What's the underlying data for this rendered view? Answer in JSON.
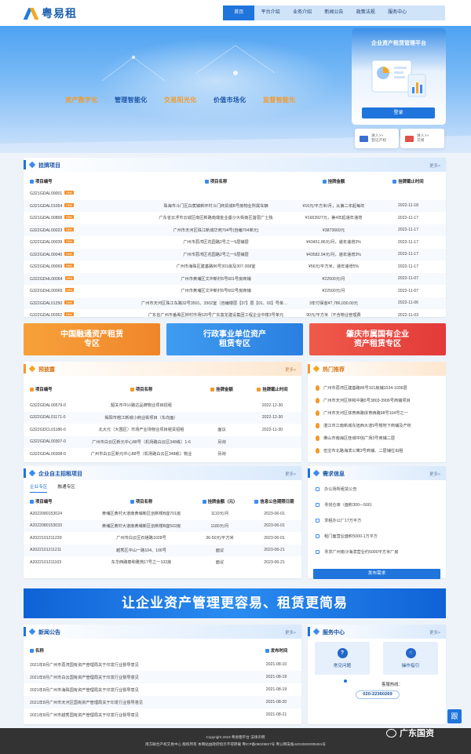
{
  "brand": {
    "name": "粤易租"
  },
  "nav": {
    "items": [
      "首页",
      "平台介绍",
      "业务介绍",
      "新闻公告",
      "政策法规",
      "服务中心"
    ],
    "active": 0
  },
  "banner": {
    "features": [
      {
        "text": "资产数字化",
        "color": "#f39a2b"
      },
      {
        "text": "管理智能化",
        "color": "#1b55a8"
      },
      {
        "text": "交易阳光化",
        "color": "#f39a2b"
      },
      {
        "text": "价值市场化",
        "color": "#1b55a8"
      },
      {
        "text": "监督智能化",
        "color": "#f39a2b"
      }
    ],
    "login_panel": {
      "title": "企业资产租赁管理平台",
      "login_btn": "登录"
    },
    "quick_btns": [
      {
        "line1": "进入>>",
        "line2": "登记产权",
        "icon": "id-card-icon",
        "color": "#3b6fd1"
      },
      {
        "line1": "进入>>",
        "line2": "交易",
        "icon": "cart-icon",
        "color": "#e1504a"
      }
    ]
  },
  "listed": {
    "title": "挂牌项目",
    "more": "更多>",
    "headers": [
      "项目编号",
      "项目名称",
      "挂牌金额",
      "挂牌截止时间"
    ],
    "rows": [
      {
        "id": "G321GDAL00001",
        "name": "",
        "amount": "",
        "date": ""
      },
      {
        "id": "G321GDAL01054",
        "name": "珠海市斗门区白蕉镇新环村斗门商贸城B号房物业所属车辆",
        "amount": "¥16元/平方米/月，从第二年起每年",
        "date": "2022-11-18"
      },
      {
        "id": "G321GDAL00868",
        "name": "广东省云浮市云城区南区新路南端金业垂沙大街南区首层广士独",
        "amount": "¥1663927元，第4年起递年递增",
        "date": "2022-11-17"
      },
      {
        "id": "G322GDAL00023",
        "name": "广州市天河区珠江新城华苑704号(自编704单元)",
        "amount": "¥3873669元",
        "date": "2022-11-17"
      },
      {
        "id": "G322GDAL00039",
        "name": "广州市荔湾区花园路2号之一5层铺层",
        "amount": "¥43451.86元/月，递年递增3%",
        "date": "2022-11-17"
      },
      {
        "id": "G322GDAL00040",
        "name": "广州市荔湾区花园路2号之一6层铺层",
        "amount": "¥43582.94元/月，递年递增3%",
        "date": "2022-11-17"
      },
      {
        "id": "G322GDAL00069",
        "name": "广州市海珠区建基路86号301房及307-308室",
        "amount": "¥56元/平方米，递年递增5%",
        "date": "2022-11-17"
      },
      {
        "id": "G322GDHL00064",
        "name": "广州市黄埔区文冲新村6号601号房商铺",
        "amount": "¥22500元/月",
        "date": "2022-11-07"
      },
      {
        "id": "G322GDHL00065",
        "name": "广州市黄埔区文冲新村6号602号房商铺",
        "amount": "¥22500元/月",
        "date": "2022-11-07"
      },
      {
        "id": "G322GDAL01250",
        "name": "广州市天河区珠江东路32号3501、3502室（自编楼层【37】层【01、02】号单元）",
        "amount": "3年付保金¥7,786,030.00元",
        "date": "2022-11-06"
      },
      {
        "id": "G322GDAL00362",
        "name": "广东省广州市番禺区钟村市场520号广东富龙建设集团工程企业中楼3号单元",
        "amount": "90元/平方米（不含物业管理费",
        "date": "2022-11-03"
      }
    ]
  },
  "zones": [
    {
      "line1": "中国融通资产租赁",
      "line2": "专区",
      "color": "#f39a2b"
    },
    {
      "line1": "行政事业单位资产",
      "line2": "租赁专区",
      "color": "#2f8ce8"
    },
    {
      "line1": "肇庆市属国有企业",
      "line2": "资产租赁专区",
      "color": "#e9483f"
    }
  ],
  "preview": {
    "title": "预披露",
    "more": "更多>",
    "headers": [
      "项目编号",
      "项目名称",
      "挂牌金额",
      "挂牌截止时间"
    ],
    "rows": [
      {
        "id": "G322GDAL00579-0",
        "name": "韶关市中兴路达品牌物业项目招租",
        "amount": "",
        "date": "2022-12-30"
      },
      {
        "id": "G322GDAL01171-0",
        "name": "揭阳市榕江新城小商业街项目（东向面）",
        "amount": "",
        "date": "2022-12-30"
      },
      {
        "id": "G322GDCL01186-0",
        "name": "北大元（大围区）市场产业场物业项目租赁招租",
        "amount": "面议",
        "date": "2022-11-30"
      },
      {
        "id": "G322GDAL00307-0",
        "name": "广州市白云区新元中心88号（机场路白云区348栋）1-6",
        "amount": "另询",
        "date": ""
      },
      {
        "id": "G322GDAL00308-0",
        "name": "广州市白云区新元中心88号（机场路白云区348栋）物业",
        "amount": "另询",
        "date": ""
      }
    ]
  },
  "hot": {
    "title": "热门推荐",
    "items": [
      "广州市荔湾区建基路86号101房铺1034-1036层",
      "广州市天河区林和中路5号3803-3906号商铺项目",
      "广州市天河区体育西路体育西路98号104号之一",
      "湛江市江南新城东旭西大道9号楼地下商铺及产权",
      "佛山市南海区桂城中信广场3号商铺二层",
      "伍宝市北路海滨公寓3号商铺、二层铺位出租"
    ]
  },
  "recruit": {
    "title": "企业自主招租项目",
    "more": "更多>",
    "tabs": [
      "企业专区",
      "融通专区"
    ],
    "headers": [
      "项目编号",
      "项目名称",
      "挂牌金额（元）",
      "信息公告期限日期"
    ],
    "rows": [
      {
        "id": "A2022080153024",
        "name": "黄埔区黄村大道南黄埔新区创新楼B座701房",
        "amount": "1110元/月",
        "date": "2023-06-01"
      },
      {
        "id": "A2022080153033",
        "name": "黄埔区黄村大道南黄埔新区创新楼B座502房",
        "amount": "1180元/月",
        "date": "2023-06-01"
      },
      {
        "id": "A2022101211239",
        "name": "广州市白云区石槎路1028号",
        "amount": "36-50元/平方米",
        "date": "2023-06-01"
      },
      {
        "id": "A2022101211211",
        "name": "越秀区中山一路104、106号",
        "amount": "面议",
        "date": "2023-06-21"
      },
      {
        "id": "A2022101211103",
        "name": "东华西路泰和雅苑17号之一102房",
        "amount": "面议",
        "date": "2023-06-21"
      }
    ]
  },
  "demand": {
    "title": "需求信息",
    "more": "更多>",
    "items": [
      "办公场所租赁公告",
      "寻找仓库（面积300—500）",
      "求租办公厂17万平方",
      "租门面营业面积5000-1万平方",
      "寻求广州南沙海滨营业约5000平方米厂房"
    ],
    "publish_btn": "发布需求"
  },
  "slogan": "让企业资产管理更容易、租赁更简易",
  "news": {
    "title": "新闻公告",
    "more": "更多>",
    "headers": [
      "名称",
      "发布时间"
    ],
    "rows": [
      {
        "name": "2021年8月广州市荔湾国有资产管理局关于印发行业督导意见",
        "date": "2021-08-10"
      },
      {
        "name": "2021年8月广州市白云国有资产管理局关于印发行业督导意见",
        "date": "2021-08-19"
      },
      {
        "name": "2021年8月广州市海珠国有资产管理局关于印发行业督导意见",
        "date": "2021-08-19"
      },
      {
        "name": "2021年8月广州市天河区国有资产管理局关于印发行业督导意见",
        "date": "2021-08-20"
      },
      {
        "name": "2021年8月广州市越秀国有资产管理局关于印发行业督导意见",
        "date": "2021-08-21"
      }
    ]
  },
  "service": {
    "title": "服务中心",
    "more": "更多>",
    "items": [
      {
        "label": "常见问题",
        "icon": "question-icon",
        "glyph": "?"
      },
      {
        "label": "操作指引",
        "icon": "hand-icon",
        "glyph": "☝"
      }
    ],
    "hotline_label": "客服热线：",
    "hotline": "020-22360269"
  },
  "footer": {
    "line1": "Copyright 2018 粤易租平台 法律声明",
    "line2": "南方联合产权交易中心 版权所有 本网站由政府指示不得转载  粤ICP备08029827号   粤公网安备44010602009451号"
  },
  "floating": {
    "glyph": "跟"
  },
  "watermark": {
    "text": "广东国资"
  }
}
